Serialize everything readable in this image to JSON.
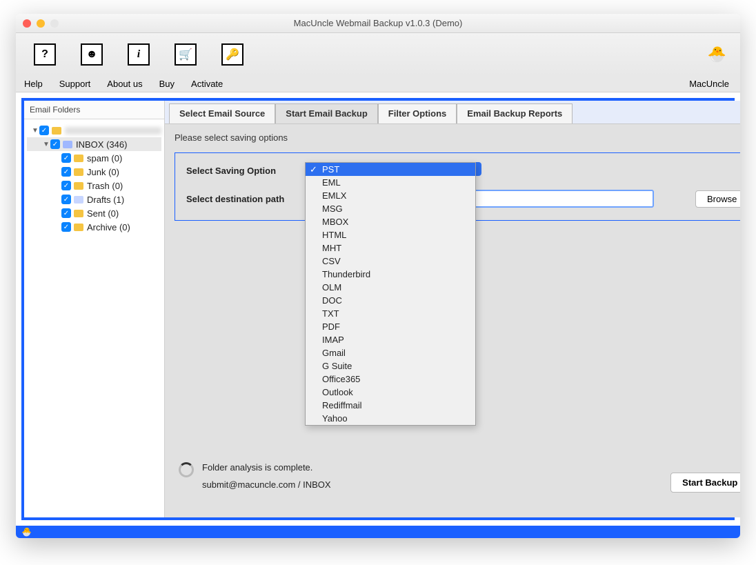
{
  "window": {
    "title": "MacUncle Webmail Backup v1.0.3 (Demo)"
  },
  "toolbar": {
    "help": "Help",
    "support": "Support",
    "about": "About us",
    "buy": "Buy",
    "activate": "Activate",
    "brand": "MacUncle"
  },
  "sidebar": {
    "title": "Email Folders",
    "account": "",
    "inbox": "INBOX (346)",
    "spam": "spam (0)",
    "junk": "Junk (0)",
    "trash": "Trash (0)",
    "drafts": "Drafts (1)",
    "sent": "Sent (0)",
    "archive": "Archive (0)"
  },
  "tabs": {
    "t0": "Select Email Source",
    "t1": "Start Email Backup",
    "t2": "Filter Options",
    "t3": "Email Backup Reports"
  },
  "panel": {
    "hint": "Please select saving options",
    "saving_label": "Select Saving Option",
    "dest_label": "Select destination path",
    "browse": "Browse",
    "start": "Start Backup"
  },
  "dropdown": {
    "options": [
      "PST",
      "EML",
      "EMLX",
      "MSG",
      "MBOX",
      "HTML",
      "MHT",
      "CSV",
      "Thunderbird",
      "OLM",
      "DOC",
      "TXT",
      "PDF",
      "IMAP",
      "Gmail",
      "G Suite",
      "Office365",
      "Outlook",
      "Rediffmail",
      "Yahoo"
    ],
    "selected": "PST"
  },
  "status": {
    "line1": "Folder analysis is complete.",
    "line2": "submit@macuncle.com / INBOX"
  }
}
